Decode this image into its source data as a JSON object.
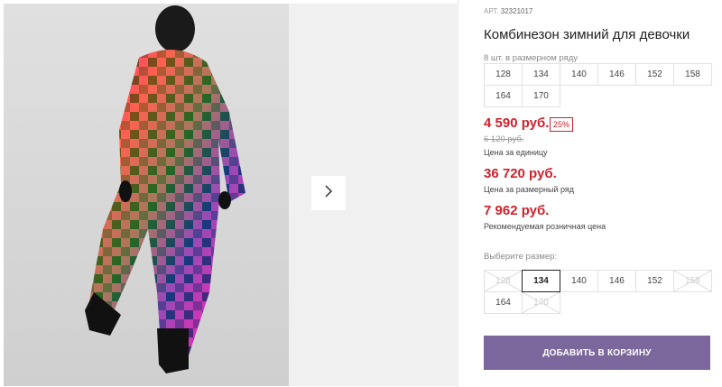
{
  "product": {
    "art_label": "АРТ.",
    "art_number": "32321017",
    "title": "Комбинезон зимний для девочки"
  },
  "size_range": {
    "label": "8 шт. в размерном ряду",
    "sizes": [
      "128",
      "134",
      "140",
      "146",
      "152",
      "158",
      "164",
      "170"
    ]
  },
  "prices": {
    "unit_price": "4 590 руб.",
    "discount_badge": "25%",
    "old_price": "6 120 руб.",
    "unit_label": "Цена за единицу",
    "range_price": "36 720 руб.",
    "range_label": "Цена за размерный ряд",
    "retail_price": "7 962 руб.",
    "retail_label": "Рекомендуемая розничная цена"
  },
  "size_picker": {
    "label": "Выберите размер:",
    "options": [
      {
        "size": "128",
        "available": false
      },
      {
        "size": "134",
        "available": true,
        "selected": true
      },
      {
        "size": "140",
        "available": true
      },
      {
        "size": "146",
        "available": true
      },
      {
        "size": "152",
        "available": true
      },
      {
        "size": "158",
        "available": false
      },
      {
        "size": "164",
        "available": true
      },
      {
        "size": "170",
        "available": false
      }
    ]
  },
  "cart": {
    "button_label": "ДОБАВИТЬ В КОРЗИНУ"
  },
  "gallery": {
    "next_icon": "chevron-right-icon"
  },
  "colors": {
    "price_red": "#d0202b",
    "accent_purple": "#7b679b"
  }
}
